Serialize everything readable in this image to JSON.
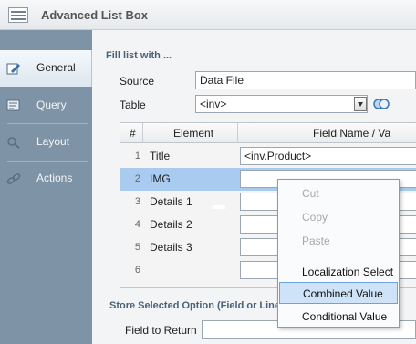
{
  "window": {
    "title": "Advanced List Box"
  },
  "sidebar": {
    "items": [
      {
        "label": "General",
        "icon": "pencil-icon",
        "active": true
      },
      {
        "label": "Query",
        "icon": "query-icon",
        "active": false
      },
      {
        "label": "Layout",
        "icon": "magnifier-icon",
        "active": false
      },
      {
        "label": "Actions",
        "icon": "link-chain-icon",
        "active": false
      }
    ]
  },
  "main": {
    "section_title": "Fill list with ...",
    "source_label": "Source",
    "source_value": "Data File",
    "table_label": "Table",
    "table_value": "<inv>",
    "grid": {
      "headers": [
        "#",
        "Element",
        "Field Name / Va"
      ],
      "rows": [
        {
          "num": "1",
          "element": "Title",
          "field": "<inv.Product>"
        },
        {
          "num": "2",
          "element": "IMG",
          "field": "",
          "selected": true
        },
        {
          "num": "3",
          "element": "Details 1",
          "field": ""
        },
        {
          "num": "4",
          "element": "Details 2",
          "field": ""
        },
        {
          "num": "5",
          "element": "Details 3",
          "field": ""
        },
        {
          "num": "6",
          "element": "",
          "field": ""
        }
      ]
    },
    "store_section_title": "Store Selected Option (Field or Line",
    "field_to_return_label": "Field to Return"
  },
  "context_menu": {
    "items": [
      {
        "label": "Cut",
        "enabled": false
      },
      {
        "label": "Copy",
        "enabled": false
      },
      {
        "label": "Paste",
        "enabled": false
      },
      {
        "label": "Localization Select",
        "enabled": true
      },
      {
        "label": "Combined Value",
        "enabled": true,
        "hovered": true
      },
      {
        "label": "Conditional Value",
        "enabled": true
      }
    ]
  },
  "colors": {
    "sidebar": "#7f93a6",
    "selected_row": "#a9cbef",
    "menu_hover": "#cfe3f8",
    "section_title": "#4a6278"
  }
}
